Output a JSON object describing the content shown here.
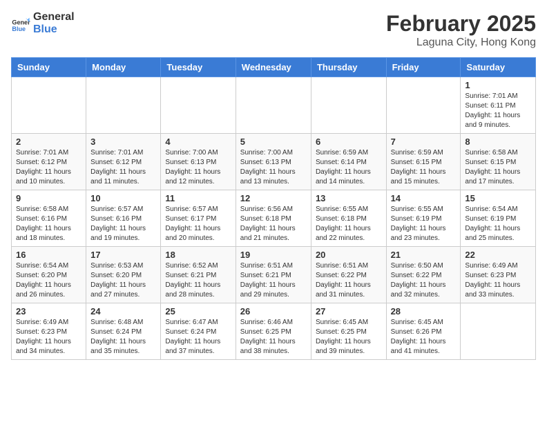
{
  "header": {
    "logo_general": "General",
    "logo_blue": "Blue",
    "title": "February 2025",
    "subtitle": "Laguna City, Hong Kong"
  },
  "calendar": {
    "days_of_week": [
      "Sunday",
      "Monday",
      "Tuesday",
      "Wednesday",
      "Thursday",
      "Friday",
      "Saturday"
    ],
    "weeks": [
      [
        {
          "day": "",
          "info": ""
        },
        {
          "day": "",
          "info": ""
        },
        {
          "day": "",
          "info": ""
        },
        {
          "day": "",
          "info": ""
        },
        {
          "day": "",
          "info": ""
        },
        {
          "day": "",
          "info": ""
        },
        {
          "day": "1",
          "info": "Sunrise: 7:01 AM\nSunset: 6:11 PM\nDaylight: 11 hours\nand 9 minutes."
        }
      ],
      [
        {
          "day": "2",
          "info": "Sunrise: 7:01 AM\nSunset: 6:12 PM\nDaylight: 11 hours\nand 10 minutes."
        },
        {
          "day": "3",
          "info": "Sunrise: 7:01 AM\nSunset: 6:12 PM\nDaylight: 11 hours\nand 11 minutes."
        },
        {
          "day": "4",
          "info": "Sunrise: 7:00 AM\nSunset: 6:13 PM\nDaylight: 11 hours\nand 12 minutes."
        },
        {
          "day": "5",
          "info": "Sunrise: 7:00 AM\nSunset: 6:13 PM\nDaylight: 11 hours\nand 13 minutes."
        },
        {
          "day": "6",
          "info": "Sunrise: 6:59 AM\nSunset: 6:14 PM\nDaylight: 11 hours\nand 14 minutes."
        },
        {
          "day": "7",
          "info": "Sunrise: 6:59 AM\nSunset: 6:15 PM\nDaylight: 11 hours\nand 15 minutes."
        },
        {
          "day": "8",
          "info": "Sunrise: 6:58 AM\nSunset: 6:15 PM\nDaylight: 11 hours\nand 17 minutes."
        }
      ],
      [
        {
          "day": "9",
          "info": "Sunrise: 6:58 AM\nSunset: 6:16 PM\nDaylight: 11 hours\nand 18 minutes."
        },
        {
          "day": "10",
          "info": "Sunrise: 6:57 AM\nSunset: 6:16 PM\nDaylight: 11 hours\nand 19 minutes."
        },
        {
          "day": "11",
          "info": "Sunrise: 6:57 AM\nSunset: 6:17 PM\nDaylight: 11 hours\nand 20 minutes."
        },
        {
          "day": "12",
          "info": "Sunrise: 6:56 AM\nSunset: 6:18 PM\nDaylight: 11 hours\nand 21 minutes."
        },
        {
          "day": "13",
          "info": "Sunrise: 6:55 AM\nSunset: 6:18 PM\nDaylight: 11 hours\nand 22 minutes."
        },
        {
          "day": "14",
          "info": "Sunrise: 6:55 AM\nSunset: 6:19 PM\nDaylight: 11 hours\nand 23 minutes."
        },
        {
          "day": "15",
          "info": "Sunrise: 6:54 AM\nSunset: 6:19 PM\nDaylight: 11 hours\nand 25 minutes."
        }
      ],
      [
        {
          "day": "16",
          "info": "Sunrise: 6:54 AM\nSunset: 6:20 PM\nDaylight: 11 hours\nand 26 minutes."
        },
        {
          "day": "17",
          "info": "Sunrise: 6:53 AM\nSunset: 6:20 PM\nDaylight: 11 hours\nand 27 minutes."
        },
        {
          "day": "18",
          "info": "Sunrise: 6:52 AM\nSunset: 6:21 PM\nDaylight: 11 hours\nand 28 minutes."
        },
        {
          "day": "19",
          "info": "Sunrise: 6:51 AM\nSunset: 6:21 PM\nDaylight: 11 hours\nand 29 minutes."
        },
        {
          "day": "20",
          "info": "Sunrise: 6:51 AM\nSunset: 6:22 PM\nDaylight: 11 hours\nand 31 minutes."
        },
        {
          "day": "21",
          "info": "Sunrise: 6:50 AM\nSunset: 6:22 PM\nDaylight: 11 hours\nand 32 minutes."
        },
        {
          "day": "22",
          "info": "Sunrise: 6:49 AM\nSunset: 6:23 PM\nDaylight: 11 hours\nand 33 minutes."
        }
      ],
      [
        {
          "day": "23",
          "info": "Sunrise: 6:49 AM\nSunset: 6:23 PM\nDaylight: 11 hours\nand 34 minutes."
        },
        {
          "day": "24",
          "info": "Sunrise: 6:48 AM\nSunset: 6:24 PM\nDaylight: 11 hours\nand 35 minutes."
        },
        {
          "day": "25",
          "info": "Sunrise: 6:47 AM\nSunset: 6:24 PM\nDaylight: 11 hours\nand 37 minutes."
        },
        {
          "day": "26",
          "info": "Sunrise: 6:46 AM\nSunset: 6:25 PM\nDaylight: 11 hours\nand 38 minutes."
        },
        {
          "day": "27",
          "info": "Sunrise: 6:45 AM\nSunset: 6:25 PM\nDaylight: 11 hours\nand 39 minutes."
        },
        {
          "day": "28",
          "info": "Sunrise: 6:45 AM\nSunset: 6:26 PM\nDaylight: 11 hours\nand 41 minutes."
        },
        {
          "day": "",
          "info": ""
        }
      ]
    ]
  }
}
